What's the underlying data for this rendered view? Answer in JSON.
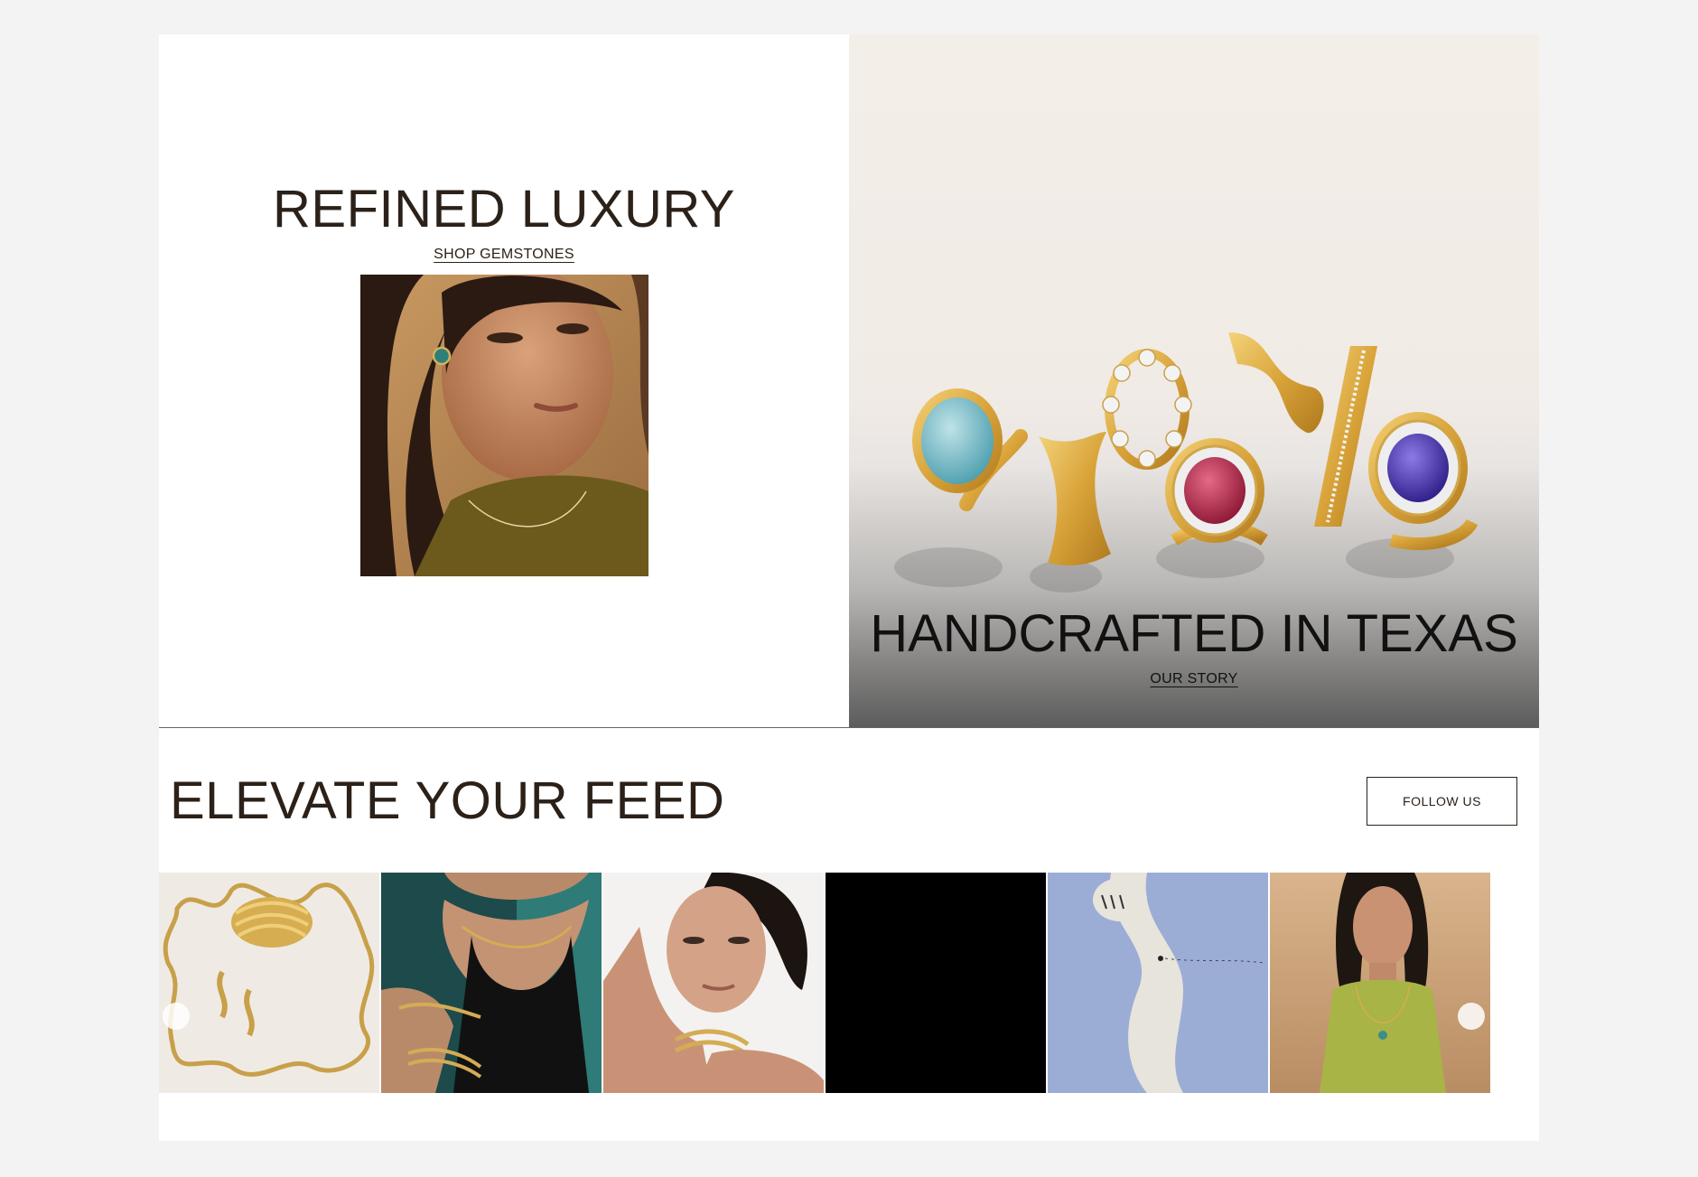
{
  "hero_left": {
    "heading": "REFINED LUXURY",
    "link": "SHOP GEMSTONES"
  },
  "hero_right": {
    "heading": "HANDCRAFTED IN TEXAS",
    "link": "OUR STORY"
  },
  "feed": {
    "heading": "ELEVATE YOUR FEED",
    "follow_label": "FOLLOW US",
    "tiles": [
      {
        "subject": "gold wave necklace, cuff and earrings"
      },
      {
        "subject": "model wearing gold necklace and bracelets"
      },
      {
        "subject": "model with gold cuff"
      },
      {
        "subject": "video tile"
      },
      {
        "subject": "abstract blue painting"
      },
      {
        "subject": "model in green dress in desert"
      }
    ]
  },
  "colors": {
    "text": "#2b2118",
    "hero_bg_top": "#f4eee9",
    "hero_bg_bottom": "#5c5c5c",
    "frame": "#f3f3f3"
  }
}
